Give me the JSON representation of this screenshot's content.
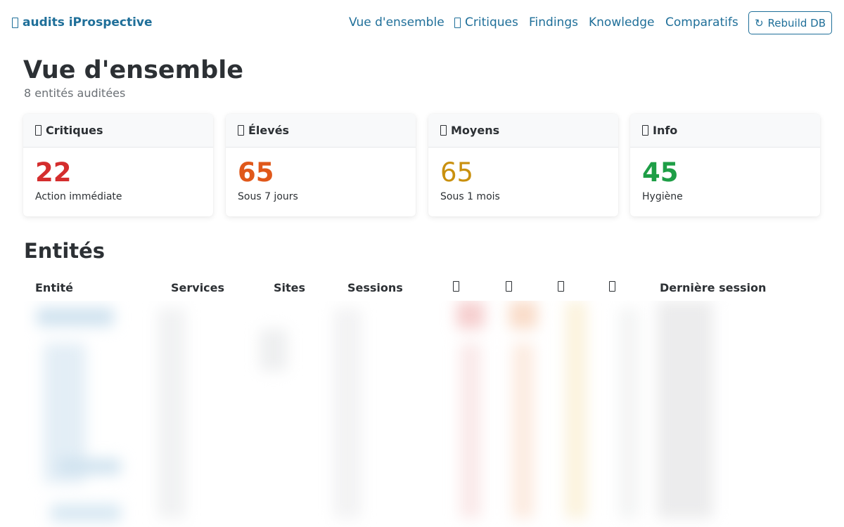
{
  "header": {
    "brand": "audits iProspective",
    "nav": [
      {
        "label": "Vue d'ensemble",
        "icon": null
      },
      {
        "label": "Critiques",
        "icon": "missing-glyph-icon"
      },
      {
        "label": "Findings",
        "icon": null
      },
      {
        "label": "Knowledge",
        "icon": null
      },
      {
        "label": "Comparatifs",
        "icon": null
      }
    ],
    "rebuild": {
      "icon": "↻",
      "label": "Rebuild DB"
    }
  },
  "overview": {
    "title": "Vue d'ensemble",
    "subtitle": "8 entités auditées"
  },
  "cards": [
    {
      "title": "Critiques",
      "value": "22",
      "caption": "Action immédiate",
      "color": "#d42d2d"
    },
    {
      "title": "Élevés",
      "value": "65",
      "caption": "Sous 7 jours",
      "color": "#e0581a"
    },
    {
      "title": "Moyens",
      "value": "65",
      "caption": "Sous 1 mois",
      "color": "#c9900e"
    },
    {
      "title": "Info",
      "value": "45",
      "caption": "Hygiène",
      "color": "#1e9e46"
    }
  ],
  "entities": {
    "title": "Entités",
    "columns": [
      "Entité",
      "Services",
      "Sites",
      "Sessions",
      "",
      "",
      "",
      "",
      "Dernière session"
    ]
  },
  "colors": {
    "accent": "#1f6f99",
    "text": "#2c3034",
    "muted": "#6b7075"
  }
}
